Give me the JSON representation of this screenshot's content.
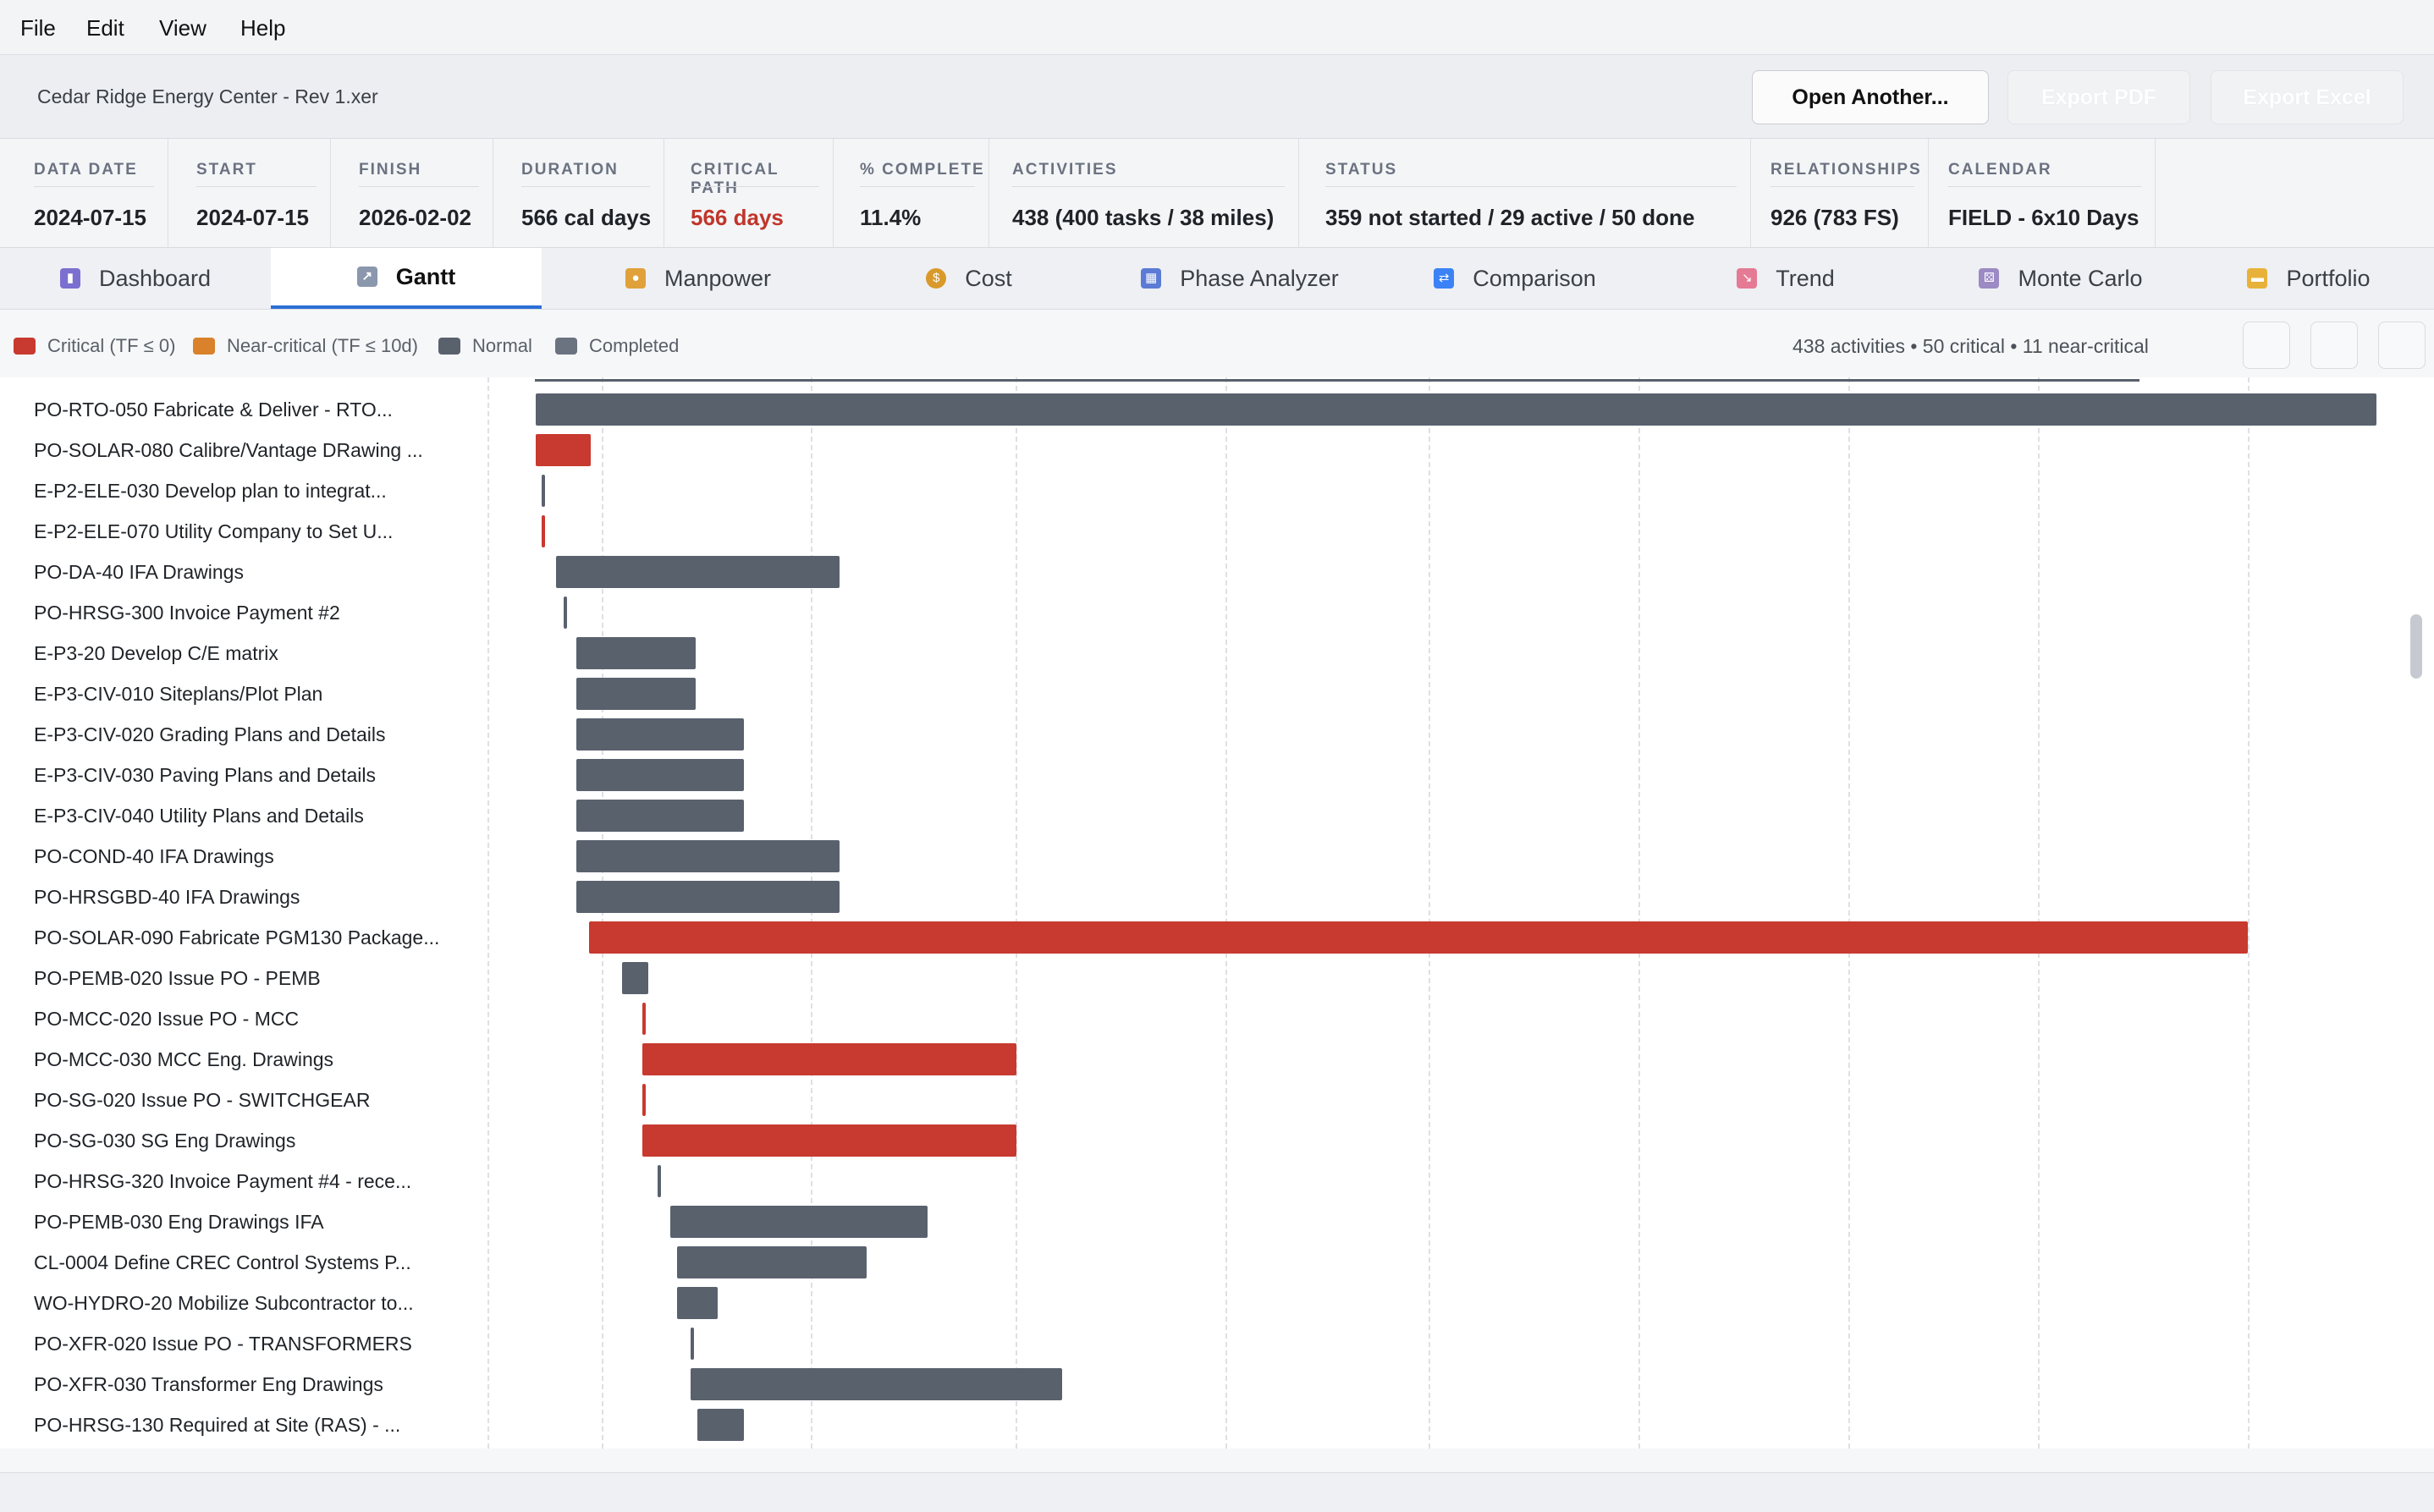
{
  "menu": [
    "File",
    "Edit",
    "View",
    "Help"
  ],
  "file_title": "Cedar Ridge Energy Center - Rev 1.xer",
  "buttons": {
    "open_another": "Open Another...",
    "export_pdf": "Export PDF",
    "export_excel": "Export Excel"
  },
  "stats": [
    {
      "label": "DATA DATE",
      "value": "2024-07-15"
    },
    {
      "label": "START",
      "value": "2024-07-15"
    },
    {
      "label": "FINISH",
      "value": "2026-02-02"
    },
    {
      "label": "DURATION",
      "value": "566 cal days"
    },
    {
      "label": "CRITICAL PATH",
      "value": "566 days"
    },
    {
      "label": "% COMPLETE",
      "value": "11.4%"
    },
    {
      "label": "ACTIVITIES",
      "value": "438  (400 tasks / 38 miles)"
    },
    {
      "label": "STATUS",
      "value": "359 not started  /  29 active  /  50 done"
    },
    {
      "label": "RELATIONSHIPS",
      "value": "926  (783 FS)"
    },
    {
      "label": "CALENDAR",
      "value": "FIELD - 6x10 Days"
    }
  ],
  "tabs": [
    {
      "label": "Dashboard",
      "icon": "bar-chart-icon"
    },
    {
      "label": "Gantt",
      "icon": "line-chart-icon",
      "active": true
    },
    {
      "label": "Manpower",
      "icon": "worker-icon"
    },
    {
      "label": "Cost",
      "icon": "money-bag-icon"
    },
    {
      "label": "Phase Analyzer",
      "icon": "calendar-icon"
    },
    {
      "label": "Comparison",
      "icon": "shuffle-icon"
    },
    {
      "label": "Trend",
      "icon": "trend-down-icon"
    },
    {
      "label": "Monte Carlo",
      "icon": "dice-icon"
    },
    {
      "label": "Portfolio",
      "icon": "folder-icon"
    }
  ],
  "legend": [
    {
      "label": "Critical (TF ≤ 0)",
      "color": "#c8392f"
    },
    {
      "label": "Near-critical (TF ≤ 10d)",
      "color": "#d9822b"
    },
    {
      "label": "Normal",
      "color": "#59616d"
    },
    {
      "label": "Completed",
      "color": "#6b7280"
    }
  ],
  "summary": "438 activities  •  50 critical  •  11 near-critical",
  "gantt": {
    "rows": [
      {
        "label": "PO-RTO-050  Fabricate & Deliver -  RTO...",
        "start": 0.0,
        "end": 1.0,
        "type": "normal"
      },
      {
        "label": "PO-SOLAR-080  Calibre/Vantage DRawing ...",
        "start": 0.0,
        "end": 0.03,
        "type": "critical"
      },
      {
        "label": "E-P2-ELE-030  Develop plan to integrat...",
        "start": 0.003,
        "end": 0.005,
        "type": "normal"
      },
      {
        "label": "E-P2-ELE-070  Utility Company to Set U...",
        "start": 0.003,
        "end": 0.005,
        "type": "critical"
      },
      {
        "label": "PO-DA-40  IFA Drawings",
        "start": 0.011,
        "end": 0.165,
        "type": "normal"
      },
      {
        "label": "PO-HRSG-300  Invoice Payment #2",
        "start": 0.015,
        "end": 0.017,
        "type": "normal"
      },
      {
        "label": "E-P3-20  Develop C/E matrix",
        "start": 0.022,
        "end": 0.087,
        "type": "normal"
      },
      {
        "label": "E-P3-CIV-010  Siteplans/Plot Plan",
        "start": 0.022,
        "end": 0.087,
        "type": "normal"
      },
      {
        "label": "E-P3-CIV-020  Grading Plans and Details",
        "start": 0.022,
        "end": 0.113,
        "type": "normal"
      },
      {
        "label": "E-P3-CIV-030  Paving Plans and Details",
        "start": 0.022,
        "end": 0.113,
        "type": "normal"
      },
      {
        "label": "E-P3-CIV-040  Utility Plans and Details",
        "start": 0.022,
        "end": 0.113,
        "type": "normal"
      },
      {
        "label": "PO-COND-40  IFA Drawings",
        "start": 0.022,
        "end": 0.165,
        "type": "normal"
      },
      {
        "label": "PO-HRSGBD-40  IFA Drawings",
        "start": 0.022,
        "end": 0.165,
        "type": "normal"
      },
      {
        "label": "PO-SOLAR-090  Fabricate PGM130 Package...",
        "start": 0.029,
        "end": 0.93,
        "type": "critical"
      },
      {
        "label": "PO-PEMB-020  Issue PO -  PEMB",
        "start": 0.047,
        "end": 0.061,
        "type": "normal"
      },
      {
        "label": "PO-MCC-020  Issue PO -  MCC",
        "start": 0.058,
        "end": 0.06,
        "type": "critical"
      },
      {
        "label": "PO-MCC-030  MCC Eng. Drawings",
        "start": 0.058,
        "end": 0.261,
        "type": "critical"
      },
      {
        "label": "PO-SG-020  Issue PO -  SWITCHGEAR",
        "start": 0.058,
        "end": 0.06,
        "type": "critical"
      },
      {
        "label": "PO-SG-030  SG Eng Drawings",
        "start": 0.058,
        "end": 0.261,
        "type": "critical"
      },
      {
        "label": "PO-HRSG-320  Invoice Payment #4 - rece...",
        "start": 0.066,
        "end": 0.068,
        "type": "normal"
      },
      {
        "label": "PO-PEMB-030  Eng Drawings IFA",
        "start": 0.073,
        "end": 0.213,
        "type": "normal"
      },
      {
        "label": "CL-0004  Define CREC Control Systems P...",
        "start": 0.077,
        "end": 0.18,
        "type": "normal"
      },
      {
        "label": "WO-HYDRO-20  Mobilize Subcontractor to...",
        "start": 0.077,
        "end": 0.099,
        "type": "normal"
      },
      {
        "label": "PO-XFR-020  Issue PO - TRANSFORMERS",
        "start": 0.084,
        "end": 0.086,
        "type": "normal"
      },
      {
        "label": "PO-XFR-030  Transformer Eng Drawings",
        "start": 0.084,
        "end": 0.286,
        "type": "normal"
      },
      {
        "label": "PO-HRSG-130  Required at Site (RAS) - ...",
        "start": 0.088,
        "end": 0.113,
        "type": "normal"
      }
    ]
  }
}
